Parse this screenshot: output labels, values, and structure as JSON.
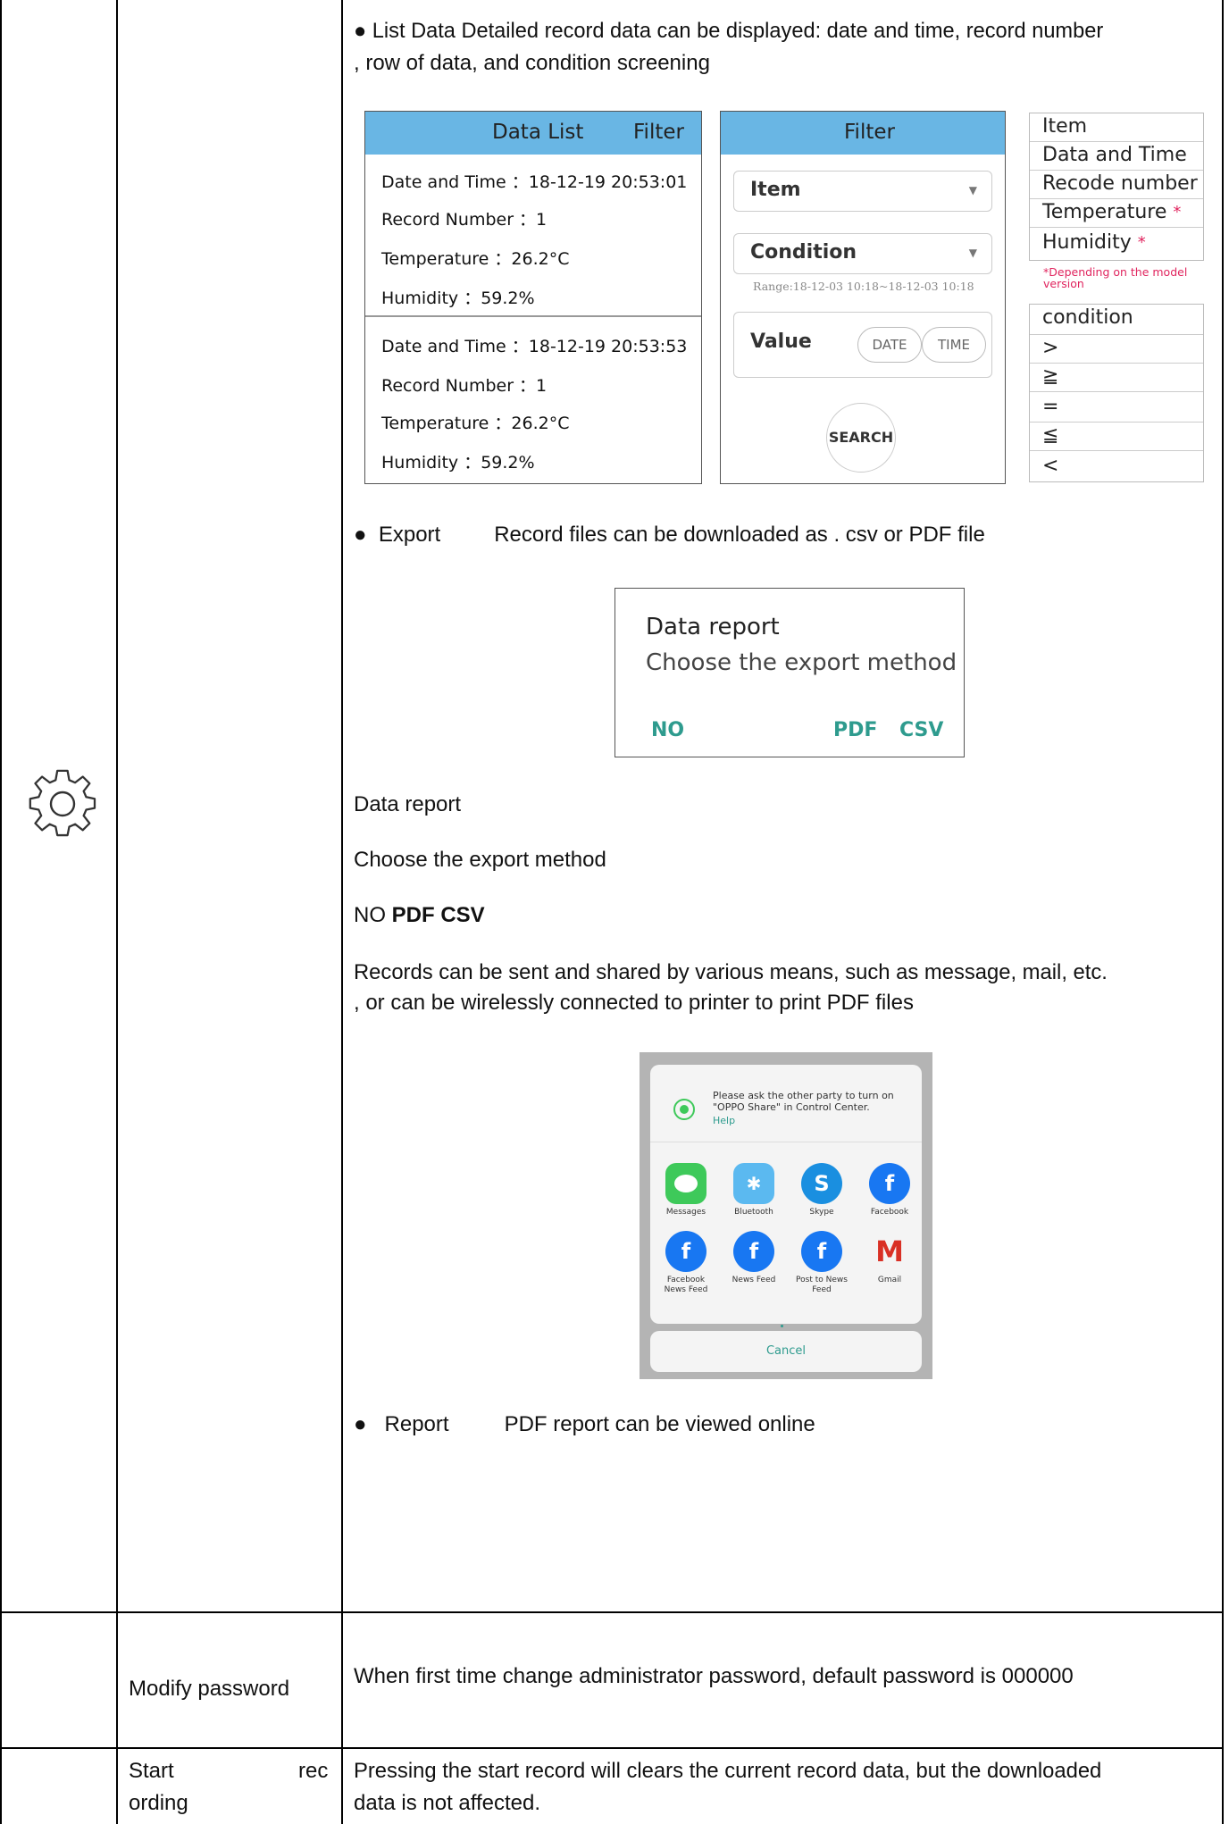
{
  "bullets": {
    "list_data": "● List Data Detailed record data can be displayed: date and time, record number",
    "list_data_cont": ", row of data, and condition screening",
    "export_label": "Export",
    "export_desc": "Record files can be downloaded as . csv or PDF file",
    "report_label": "Report",
    "report_desc": "PDF report can be viewed online",
    "bullet_glyph": "●"
  },
  "data_list_panel": {
    "title": "Data List",
    "filter_link": "Filter",
    "records": [
      {
        "date_time": "Date and Time ：18-12-19 20:53:01",
        "record_number": "Record Number ：1",
        "temperature": "Temperature ：26.2°C",
        "humidity": "Humidity ：59.2%"
      },
      {
        "date_time": "Date and Time ：18-12-19 20:53:53",
        "record_number": "Record Number ：1",
        "temperature": "Temperature ：26.2°C",
        "humidity": "Humidity ：59.2%"
      }
    ]
  },
  "filter_panel": {
    "title": "Filter",
    "item_select": "Item",
    "condition_select": "Condition",
    "range": "Range:18-12-03 10:18~18-12-03 10:18",
    "value_label": "Value",
    "date_button": "DATE",
    "time_button": "TIME",
    "search_button": "SEARCH"
  },
  "item_options": {
    "rows": [
      "Item",
      "Data and Time",
      "Recode number",
      "Temperature",
      "Humidity"
    ],
    "note": "Depending on the model version",
    "asterisk": "*"
  },
  "condition_options": {
    "rows": [
      "condition",
      ">",
      "≧",
      "=",
      "≦",
      "<"
    ]
  },
  "export_dialog": {
    "title": "Data report",
    "subtitle": "Choose the export method",
    "no": "NO",
    "pdf": "PDF",
    "csv": "CSV"
  },
  "export_text": {
    "line1": "Data report",
    "line2": "Choose the export method",
    "line3_no": "NO",
    "line3_bold": "PDF CSV",
    "share_p1": "Records can be sent and shared by various means, such as message, mail, etc.",
    "share_p2": ", or can be wirelessly connected to printer to print PDF files"
  },
  "share_sheet": {
    "prompt": "Please ask the other party to turn on \"OPPO Share\" in Control Center.",
    "help": "Help",
    "apps": [
      {
        "label": "Messages",
        "icon": "messages-icon",
        "color": "#3ec95a"
      },
      {
        "label": "Bluetooth",
        "icon": "bluetooth-icon",
        "color": "#5bb9f0"
      },
      {
        "label": "Skype",
        "icon": "skype-icon",
        "color": "#1a8fe0"
      },
      {
        "label": "Facebook",
        "icon": "facebook-icon",
        "color": "#1877f2"
      },
      {
        "label": "Facebook News Feed",
        "icon": "facebook-icon",
        "color": "#1877f2"
      },
      {
        "label": "News Feed",
        "icon": "facebook-icon",
        "color": "#1877f2"
      },
      {
        "label": "Post to News Feed",
        "icon": "facebook-icon",
        "color": "#1877f2"
      },
      {
        "label": "Gmail",
        "icon": "gmail-icon",
        "color": "#d93025"
      }
    ],
    "cancel": "Cancel"
  },
  "table_rows": {
    "modify_password_label": "Modify password",
    "modify_password_desc": "When first time change administrator password, default password is 000000",
    "start_label_a": "Start",
    "start_label_b": "rec",
    "start_label_c": "ording",
    "start_desc_1": "Pressing the start record will clears the current record data, but the downloaded",
    "start_desc_2": "data is not affected."
  }
}
